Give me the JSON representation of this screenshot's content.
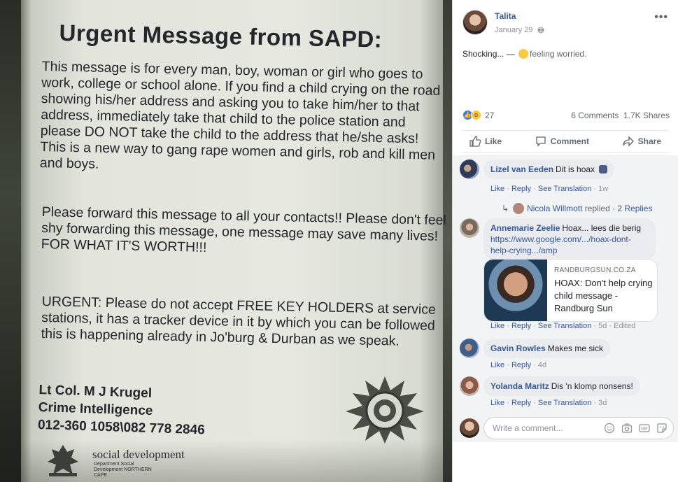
{
  "notice": {
    "title": "Urgent Message from SAPD:",
    "paragraph1": "This message is for every man, boy, woman or girl who goes to work, college or school alone.  If you find a child crying on the road showing his/her address and asking you to take him/her to that address, immediately take that child to the police station and please DO NOT take the child to the address that he/she asks!  This is a new way to gang rape women and girls, rob and kill men and boys.",
    "paragraph2": "Please forward this message to all your contacts!! Please don't feel shy forwarding this message, one message may save many lives! FOR WHAT IT'S WORTH!!!",
    "paragraph3": "URGENT:  Please do not accept FREE KEY HOLDERS at service stations, it has a tracker device in it by which you can be followed this is happening already in Jo'burg & Durban as we speak.",
    "signature": {
      "name": "Lt Col. M J Krugel",
      "unit": "Crime Intelligence",
      "phone": "012-360 1058\\082 778 2846"
    },
    "department": "social development",
    "department_sub": "Department Social Development NORTHERN CAPE"
  },
  "post": {
    "author": "Talita",
    "date": "January 29",
    "text": "Shocking... —",
    "feeling": "feeling worried.",
    "reaction_count": "27",
    "comments_count": "6 Comments",
    "shares_count": "1.7K Shares",
    "actions": {
      "like": "Like",
      "comment": "Comment",
      "share": "Share"
    }
  },
  "comments": [
    {
      "name": "Lizel van Eeden",
      "text": "Dit is hoax",
      "meta": {
        "like": "Like",
        "reply": "Reply",
        "translate": "See Translation",
        "time": "1w"
      },
      "reply_summary": {
        "name": "Nicola Willmott",
        "verb": "replied",
        "count": "2 Replies"
      }
    },
    {
      "name": "Annemarie Zeelie",
      "text": "Hoax... lees die berig",
      "link_text": "https://www.google.com/.../hoax-dont-help-crying.../amp",
      "card": {
        "domain": "RANDBURGSUN.CO.ZA",
        "title": "HOAX: Don't help crying child message - Randburg Sun"
      },
      "meta": {
        "like": "Like",
        "reply": "Reply",
        "translate": "See Translation",
        "time": "5d",
        "edited": "Edited"
      }
    },
    {
      "name": "Gavin Rowles",
      "text": "Makes me sick",
      "meta": {
        "like": "Like",
        "reply": "Reply",
        "time": "4d"
      }
    },
    {
      "name": "Yolanda Maritz",
      "text": "Dis 'n klomp nonsens!",
      "meta": {
        "like": "Like",
        "reply": "Reply",
        "translate": "See Translation",
        "time": "3d"
      }
    }
  ],
  "composer": {
    "placeholder": "Write a comment...",
    "icons": [
      "emoji-icon",
      "camera-icon",
      "gif-icon",
      "sticker-icon"
    ]
  },
  "colors": {
    "link_blue": "#385898",
    "meta_gray": "#90949c",
    "bubble_bg": "#e9ebee",
    "comments_bg": "#f2f3f5"
  }
}
